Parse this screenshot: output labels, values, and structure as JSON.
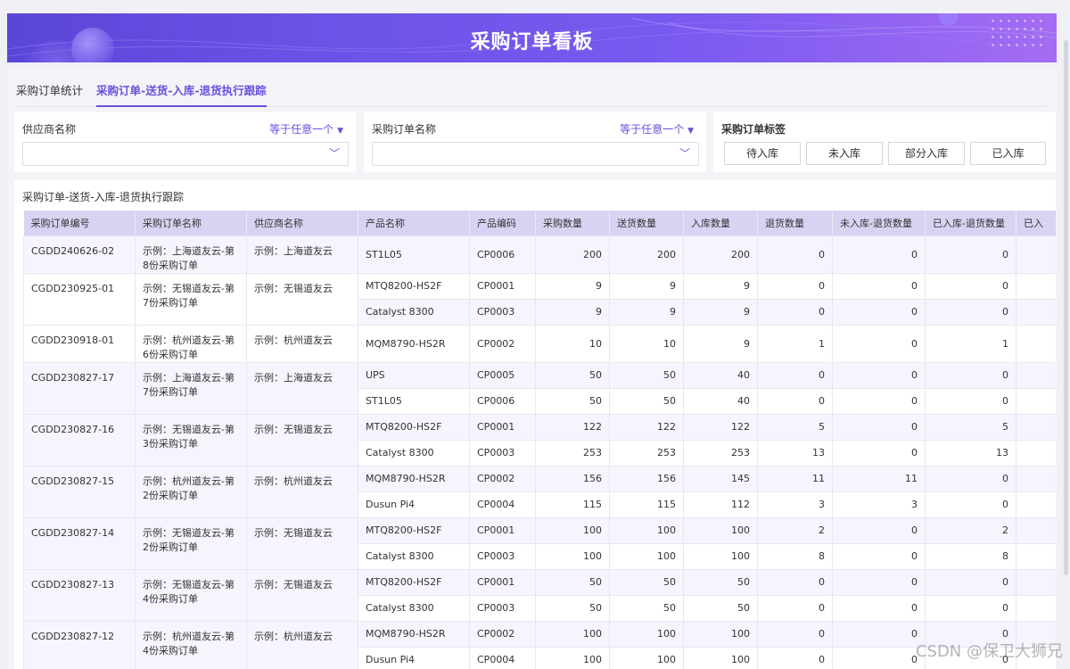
{
  "banner": {
    "title": "采购订单看板"
  },
  "tabs": [
    {
      "label": "采购订单统计",
      "active": false
    },
    {
      "label": "采购订单-送货-入库-退货执行跟踪",
      "active": true
    }
  ],
  "filters": {
    "supplier": {
      "label": "供应商名称",
      "operator": "等于任意一个",
      "value": ""
    },
    "order_name": {
      "label": "采购订单名称",
      "operator": "等于任意一个",
      "value": ""
    },
    "tags": {
      "label": "采购订单标签",
      "options": [
        "待入库",
        "未入库",
        "部分入库",
        "已入库"
      ]
    }
  },
  "table": {
    "title": "采购订单-送货-入库-退货执行跟踪",
    "columns": [
      "采购订单编号",
      "采购订单名称",
      "供应商名称",
      "产品名称",
      "产品编码",
      "采购数量",
      "送货数量",
      "入库数量",
      "退货数量",
      "未入库-退货数量",
      "已入库-退货数量",
      "已入"
    ],
    "orders": [
      {
        "id": "CGDD240626-02",
        "name": "示例：上海道友云-第8份采购订单",
        "supplier": "示例：上海道友云",
        "rows": [
          {
            "product": "ST1L05",
            "code": "CP0006",
            "qty": "200",
            "delivered": "200",
            "stocked": "200",
            "returned": "0",
            "ret_unstocked": "0",
            "ret_stocked": "0"
          }
        ]
      },
      {
        "id": "CGDD230925-01",
        "name": "示例：无锡道友云-第7份采购订单",
        "supplier": "示例：无锡道友云",
        "rows": [
          {
            "product": "MTQ8200-HS2F",
            "code": "CP0001",
            "qty": "9",
            "delivered": "9",
            "stocked": "9",
            "returned": "0",
            "ret_unstocked": "0",
            "ret_stocked": "0"
          },
          {
            "product": "Catalyst 8300",
            "code": "CP0003",
            "qty": "9",
            "delivered": "9",
            "stocked": "9",
            "returned": "0",
            "ret_unstocked": "0",
            "ret_stocked": "0"
          }
        ]
      },
      {
        "id": "CGDD230918-01",
        "name": "示例：杭州道友云-第6份采购订单",
        "supplier": "示例：杭州道友云",
        "rows": [
          {
            "product": "MQM8790-HS2R",
            "code": "CP0002",
            "qty": "10",
            "delivered": "10",
            "stocked": "9",
            "returned": "1",
            "ret_unstocked": "0",
            "ret_stocked": "1"
          }
        ]
      },
      {
        "id": "CGDD230827-17",
        "name": "示例：上海道友云-第7份采购订单",
        "supplier": "示例：上海道友云",
        "rows": [
          {
            "product": "UPS",
            "code": "CP0005",
            "qty": "50",
            "delivered": "50",
            "stocked": "40",
            "returned": "0",
            "ret_unstocked": "0",
            "ret_stocked": "0"
          },
          {
            "product": "ST1L05",
            "code": "CP0006",
            "qty": "50",
            "delivered": "50",
            "stocked": "40",
            "returned": "0",
            "ret_unstocked": "0",
            "ret_stocked": "0"
          }
        ]
      },
      {
        "id": "CGDD230827-16",
        "name": "示例：无锡道友云-第3份采购订单",
        "supplier": "示例：无锡道友云",
        "rows": [
          {
            "product": "MTQ8200-HS2F",
            "code": "CP0001",
            "qty": "122",
            "delivered": "122",
            "stocked": "122",
            "returned": "5",
            "ret_unstocked": "0",
            "ret_stocked": "5"
          },
          {
            "product": "Catalyst 8300",
            "code": "CP0003",
            "qty": "253",
            "delivered": "253",
            "stocked": "253",
            "returned": "13",
            "ret_unstocked": "0",
            "ret_stocked": "13"
          }
        ]
      },
      {
        "id": "CGDD230827-15",
        "name": "示例：杭州道友云-第2份采购订单",
        "supplier": "示例：杭州道友云",
        "rows": [
          {
            "product": "MQM8790-HS2R",
            "code": "CP0002",
            "qty": "156",
            "delivered": "156",
            "stocked": "145",
            "returned": "11",
            "ret_unstocked": "11",
            "ret_stocked": "0"
          },
          {
            "product": "Dusun Pi4",
            "code": "CP0004",
            "qty": "115",
            "delivered": "115",
            "stocked": "112",
            "returned": "3",
            "ret_unstocked": "3",
            "ret_stocked": "0"
          }
        ]
      },
      {
        "id": "CGDD230827-14",
        "name": "示例：无锡道友云-第2份采购订单",
        "supplier": "示例：无锡道友云",
        "rows": [
          {
            "product": "MTQ8200-HS2F",
            "code": "CP0001",
            "qty": "100",
            "delivered": "100",
            "stocked": "100",
            "returned": "2",
            "ret_unstocked": "0",
            "ret_stocked": "2"
          },
          {
            "product": "Catalyst 8300",
            "code": "CP0003",
            "qty": "100",
            "delivered": "100",
            "stocked": "100",
            "returned": "8",
            "ret_unstocked": "0",
            "ret_stocked": "8"
          }
        ]
      },
      {
        "id": "CGDD230827-13",
        "name": "示例：无锡道友云-第4份采购订单",
        "supplier": "示例：无锡道友云",
        "rows": [
          {
            "product": "MTQ8200-HS2F",
            "code": "CP0001",
            "qty": "50",
            "delivered": "50",
            "stocked": "50",
            "returned": "0",
            "ret_unstocked": "0",
            "ret_stocked": "0"
          },
          {
            "product": "Catalyst 8300",
            "code": "CP0003",
            "qty": "50",
            "delivered": "50",
            "stocked": "50",
            "returned": "0",
            "ret_unstocked": "0",
            "ret_stocked": "0"
          }
        ]
      },
      {
        "id": "CGDD230827-12",
        "name": "示例：杭州道友云-第4份采购订单",
        "supplier": "示例：杭州道友云",
        "rows": [
          {
            "product": "MQM8790-HS2R",
            "code": "CP0002",
            "qty": "100",
            "delivered": "100",
            "stocked": "100",
            "returned": "0",
            "ret_unstocked": "0",
            "ret_stocked": "0"
          },
          {
            "product": "Dusun Pi4",
            "code": "CP0004",
            "qty": "100",
            "delivered": "100",
            "stocked": "100",
            "returned": "0",
            "ret_unstocked": "0",
            "ret_stocked": "0"
          }
        ]
      }
    ]
  },
  "watermark": "CSDN @保卫大狮兄"
}
